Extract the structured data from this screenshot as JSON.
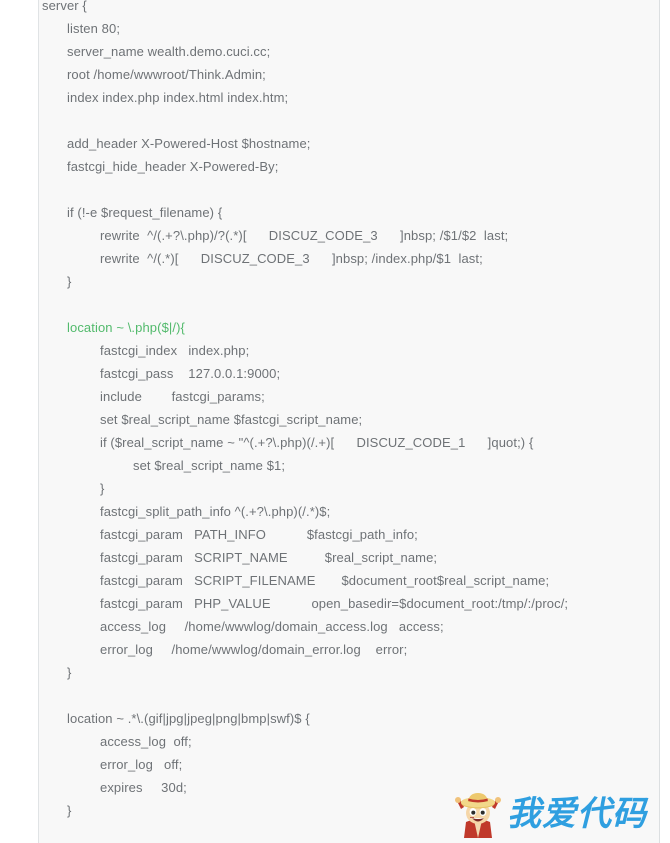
{
  "code_block": {
    "language": "nginx",
    "background_color": "#f8f8f8",
    "text_color": "#6e7276",
    "highlight_color": "#52ba6c",
    "lines": [
      {
        "text": "server {",
        "indent": 0,
        "style": "normal"
      },
      {
        "text": "listen 80;",
        "indent": 1,
        "style": "normal"
      },
      {
        "text": "server_name wealth.demo.cuci.cc;",
        "indent": 1,
        "style": "normal"
      },
      {
        "text": "root /home/wwwroot/Think.Admin;",
        "indent": 1,
        "style": "normal"
      },
      {
        "text": "index index.php index.html index.htm;",
        "indent": 1,
        "style": "normal"
      },
      {
        "text": "",
        "indent": 0,
        "style": "blank"
      },
      {
        "text": "add_header X-Powered-Host $hostname;",
        "indent": 1,
        "style": "normal"
      },
      {
        "text": "fastcgi_hide_header X-Powered-By;",
        "indent": 1,
        "style": "normal"
      },
      {
        "text": "",
        "indent": 0,
        "style": "blank"
      },
      {
        "text": "if (!-e $request_filename) {",
        "indent": 1,
        "style": "normal"
      },
      {
        "text": "rewrite  ^/(.+?\\.php)/?(.*)[      DISCUZ_CODE_3      ]nbsp; /$1/$2  last;",
        "indent": 2,
        "style": "normal"
      },
      {
        "text": "rewrite  ^/(.*)[      DISCUZ_CODE_3      ]nbsp; /index.php/$1  last;",
        "indent": 2,
        "style": "normal"
      },
      {
        "text": "}",
        "indent": 1,
        "style": "normal"
      },
      {
        "text": "",
        "indent": 0,
        "style": "blank"
      },
      {
        "text": "location ~ \\.php($|/){",
        "indent": 1,
        "style": "green"
      },
      {
        "text": "fastcgi_index   index.php;",
        "indent": 2,
        "style": "normal"
      },
      {
        "text": "fastcgi_pass    127.0.0.1:9000;",
        "indent": 2,
        "style": "normal"
      },
      {
        "text": "include        fastcgi_params;",
        "indent": 2,
        "style": "normal"
      },
      {
        "text": "set $real_script_name $fastcgi_script_name;",
        "indent": 2,
        "style": "normal"
      },
      {
        "text": "if ($real_script_name ~ \"^(.+?\\.php)(/.+)[      DISCUZ_CODE_1      ]quot;) {",
        "indent": 2,
        "style": "normal"
      },
      {
        "text": "set $real_script_name $1;",
        "indent": 3,
        "style": "normal"
      },
      {
        "text": "}",
        "indent": 2,
        "style": "normal"
      },
      {
        "text": "fastcgi_split_path_info ^(.+?\\.php)(/.*)$;",
        "indent": 2,
        "style": "normal"
      },
      {
        "text": "fastcgi_param   PATH_INFO           $fastcgi_path_info;",
        "indent": 2,
        "style": "normal"
      },
      {
        "text": "fastcgi_param   SCRIPT_NAME          $real_script_name;",
        "indent": 2,
        "style": "normal"
      },
      {
        "text": "fastcgi_param   SCRIPT_FILENAME       $document_root$real_script_name;",
        "indent": 2,
        "style": "normal"
      },
      {
        "text": "fastcgi_param   PHP_VALUE           open_basedir=$document_root:/tmp/:/proc/;",
        "indent": 2,
        "style": "normal"
      },
      {
        "text": "access_log     /home/wwwlog/domain_access.log   access;",
        "indent": 2,
        "style": "normal"
      },
      {
        "text": "error_log     /home/wwwlog/domain_error.log    error;",
        "indent": 2,
        "style": "normal"
      },
      {
        "text": "}",
        "indent": 1,
        "style": "normal"
      },
      {
        "text": "",
        "indent": 0,
        "style": "blank"
      },
      {
        "text": "location ~ .*\\.(gif|jpg|jpeg|png|bmp|swf)$ {",
        "indent": 1,
        "style": "normal"
      },
      {
        "text": "access_log  off;",
        "indent": 2,
        "style": "normal"
      },
      {
        "text": "error_log   off;",
        "indent": 2,
        "style": "normal"
      },
      {
        "text": "expires     30d;",
        "indent": 2,
        "style": "normal"
      },
      {
        "text": "}",
        "indent": 1,
        "style": "normal"
      }
    ]
  },
  "watermark": {
    "text": "我爱代码",
    "text_color": "#2f9fe0",
    "mascot": "straw-hat-boy-mascot"
  }
}
